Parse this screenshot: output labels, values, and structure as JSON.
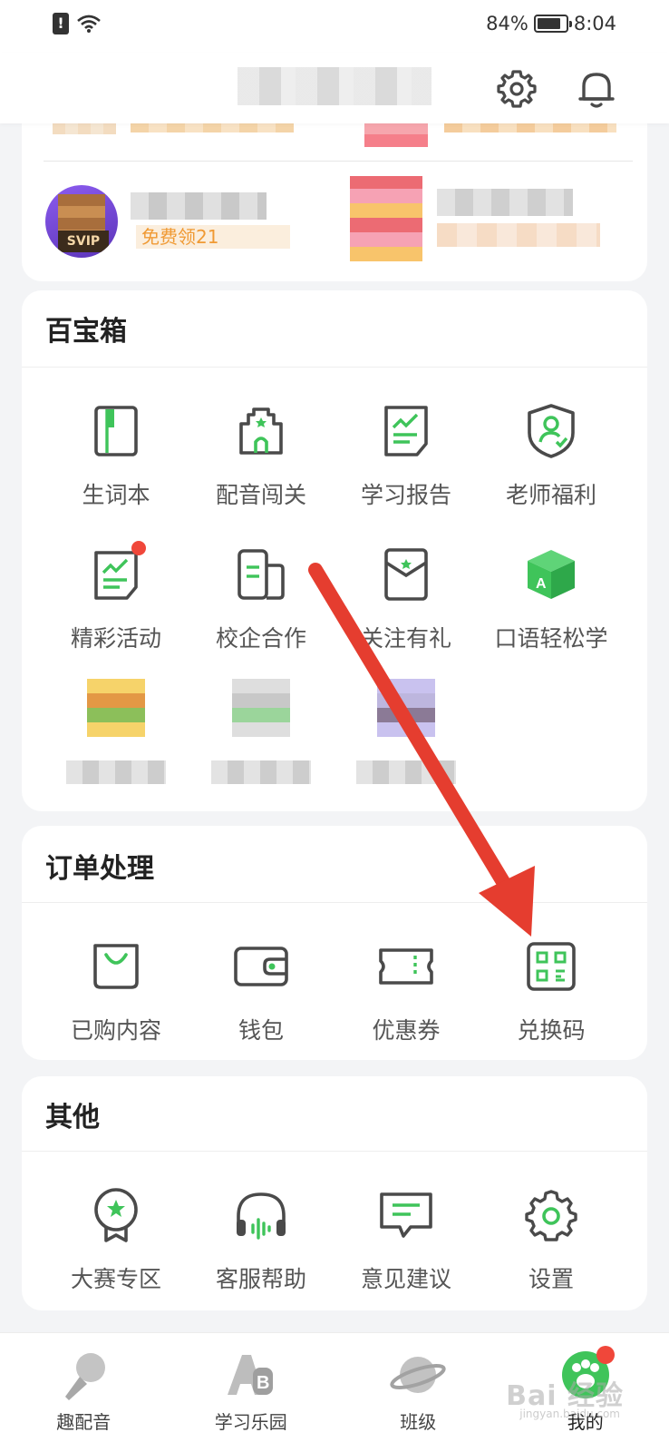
{
  "status_bar": {
    "battery": "84%",
    "battery_level": 0.84,
    "time": "8:04"
  },
  "header": {
    "settings_icon": "gear-icon",
    "notification_icon": "bell-icon"
  },
  "vip_card": {
    "svip_badge": "SVIP",
    "promo_text": "免费领21"
  },
  "toolbox": {
    "title": "百宝箱",
    "items": [
      {
        "label": "生词本",
        "icon": "notebook-icon"
      },
      {
        "label": "配音闯关",
        "icon": "castle-icon"
      },
      {
        "label": "学习报告",
        "icon": "report-icon"
      },
      {
        "label": "老师福利",
        "icon": "teacher-shield-icon"
      },
      {
        "label": "精彩活动",
        "icon": "activity-icon",
        "badge": true
      },
      {
        "label": "校企合作",
        "icon": "cooperation-icon"
      },
      {
        "label": "关注有礼",
        "icon": "gift-envelope-icon"
      },
      {
        "label": "口语轻松学",
        "icon": "speaking-cube-icon"
      }
    ]
  },
  "orders": {
    "title": "订单处理",
    "items": [
      {
        "label": "已购内容",
        "icon": "shopping-bag-icon"
      },
      {
        "label": "钱包",
        "icon": "wallet-icon"
      },
      {
        "label": "优惠券",
        "icon": "coupon-icon"
      },
      {
        "label": "兑换码",
        "icon": "redeem-code-icon"
      }
    ]
  },
  "others": {
    "title": "其他",
    "items": [
      {
        "label": "大赛专区",
        "icon": "medal-icon"
      },
      {
        "label": "客服帮助",
        "icon": "headset-icon"
      },
      {
        "label": "意见建议",
        "icon": "feedback-icon"
      },
      {
        "label": "设置",
        "icon": "gear-icon"
      }
    ]
  },
  "bottom_nav": {
    "items": [
      {
        "label": "趣配音",
        "icon": "microphone-icon"
      },
      {
        "label": "学习乐园",
        "icon": "ab-icon"
      },
      {
        "label": "班级",
        "icon": "planet-icon"
      },
      {
        "label": "我的",
        "icon": "paw-icon",
        "active": true
      }
    ]
  },
  "watermark": {
    "text": "Bai 经验",
    "sub": "jingyan.baidu.com"
  },
  "colors": {
    "accent_green": "#3fc45a",
    "icon_gray": "#4a4a4a",
    "alert_red": "#f0473a",
    "arrow_red": "#e53d2f"
  }
}
